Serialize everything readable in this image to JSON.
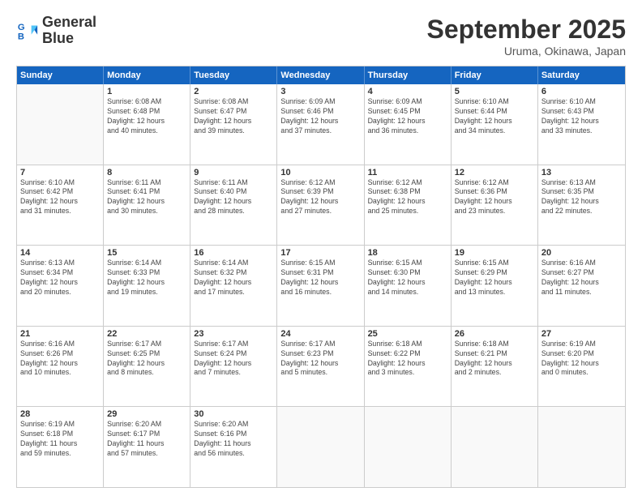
{
  "logo": {
    "line1": "General",
    "line2": "Blue"
  },
  "title": "September 2025",
  "location": "Uruma, Okinawa, Japan",
  "days_header": [
    "Sunday",
    "Monday",
    "Tuesday",
    "Wednesday",
    "Thursday",
    "Friday",
    "Saturday"
  ],
  "weeks": [
    [
      {
        "day": "",
        "info": ""
      },
      {
        "day": "1",
        "info": "Sunrise: 6:08 AM\nSunset: 6:48 PM\nDaylight: 12 hours\nand 40 minutes."
      },
      {
        "day": "2",
        "info": "Sunrise: 6:08 AM\nSunset: 6:47 PM\nDaylight: 12 hours\nand 39 minutes."
      },
      {
        "day": "3",
        "info": "Sunrise: 6:09 AM\nSunset: 6:46 PM\nDaylight: 12 hours\nand 37 minutes."
      },
      {
        "day": "4",
        "info": "Sunrise: 6:09 AM\nSunset: 6:45 PM\nDaylight: 12 hours\nand 36 minutes."
      },
      {
        "day": "5",
        "info": "Sunrise: 6:10 AM\nSunset: 6:44 PM\nDaylight: 12 hours\nand 34 minutes."
      },
      {
        "day": "6",
        "info": "Sunrise: 6:10 AM\nSunset: 6:43 PM\nDaylight: 12 hours\nand 33 minutes."
      }
    ],
    [
      {
        "day": "7",
        "info": "Sunrise: 6:10 AM\nSunset: 6:42 PM\nDaylight: 12 hours\nand 31 minutes."
      },
      {
        "day": "8",
        "info": "Sunrise: 6:11 AM\nSunset: 6:41 PM\nDaylight: 12 hours\nand 30 minutes."
      },
      {
        "day": "9",
        "info": "Sunrise: 6:11 AM\nSunset: 6:40 PM\nDaylight: 12 hours\nand 28 minutes."
      },
      {
        "day": "10",
        "info": "Sunrise: 6:12 AM\nSunset: 6:39 PM\nDaylight: 12 hours\nand 27 minutes."
      },
      {
        "day": "11",
        "info": "Sunrise: 6:12 AM\nSunset: 6:38 PM\nDaylight: 12 hours\nand 25 minutes."
      },
      {
        "day": "12",
        "info": "Sunrise: 6:12 AM\nSunset: 6:36 PM\nDaylight: 12 hours\nand 23 minutes."
      },
      {
        "day": "13",
        "info": "Sunrise: 6:13 AM\nSunset: 6:35 PM\nDaylight: 12 hours\nand 22 minutes."
      }
    ],
    [
      {
        "day": "14",
        "info": "Sunrise: 6:13 AM\nSunset: 6:34 PM\nDaylight: 12 hours\nand 20 minutes."
      },
      {
        "day": "15",
        "info": "Sunrise: 6:14 AM\nSunset: 6:33 PM\nDaylight: 12 hours\nand 19 minutes."
      },
      {
        "day": "16",
        "info": "Sunrise: 6:14 AM\nSunset: 6:32 PM\nDaylight: 12 hours\nand 17 minutes."
      },
      {
        "day": "17",
        "info": "Sunrise: 6:15 AM\nSunset: 6:31 PM\nDaylight: 12 hours\nand 16 minutes."
      },
      {
        "day": "18",
        "info": "Sunrise: 6:15 AM\nSunset: 6:30 PM\nDaylight: 12 hours\nand 14 minutes."
      },
      {
        "day": "19",
        "info": "Sunrise: 6:15 AM\nSunset: 6:29 PM\nDaylight: 12 hours\nand 13 minutes."
      },
      {
        "day": "20",
        "info": "Sunrise: 6:16 AM\nSunset: 6:27 PM\nDaylight: 12 hours\nand 11 minutes."
      }
    ],
    [
      {
        "day": "21",
        "info": "Sunrise: 6:16 AM\nSunset: 6:26 PM\nDaylight: 12 hours\nand 10 minutes."
      },
      {
        "day": "22",
        "info": "Sunrise: 6:17 AM\nSunset: 6:25 PM\nDaylight: 12 hours\nand 8 minutes."
      },
      {
        "day": "23",
        "info": "Sunrise: 6:17 AM\nSunset: 6:24 PM\nDaylight: 12 hours\nand 7 minutes."
      },
      {
        "day": "24",
        "info": "Sunrise: 6:17 AM\nSunset: 6:23 PM\nDaylight: 12 hours\nand 5 minutes."
      },
      {
        "day": "25",
        "info": "Sunrise: 6:18 AM\nSunset: 6:22 PM\nDaylight: 12 hours\nand 3 minutes."
      },
      {
        "day": "26",
        "info": "Sunrise: 6:18 AM\nSunset: 6:21 PM\nDaylight: 12 hours\nand 2 minutes."
      },
      {
        "day": "27",
        "info": "Sunrise: 6:19 AM\nSunset: 6:20 PM\nDaylight: 12 hours\nand 0 minutes."
      }
    ],
    [
      {
        "day": "28",
        "info": "Sunrise: 6:19 AM\nSunset: 6:18 PM\nDaylight: 11 hours\nand 59 minutes."
      },
      {
        "day": "29",
        "info": "Sunrise: 6:20 AM\nSunset: 6:17 PM\nDaylight: 11 hours\nand 57 minutes."
      },
      {
        "day": "30",
        "info": "Sunrise: 6:20 AM\nSunset: 6:16 PM\nDaylight: 11 hours\nand 56 minutes."
      },
      {
        "day": "",
        "info": ""
      },
      {
        "day": "",
        "info": ""
      },
      {
        "day": "",
        "info": ""
      },
      {
        "day": "",
        "info": ""
      }
    ]
  ]
}
